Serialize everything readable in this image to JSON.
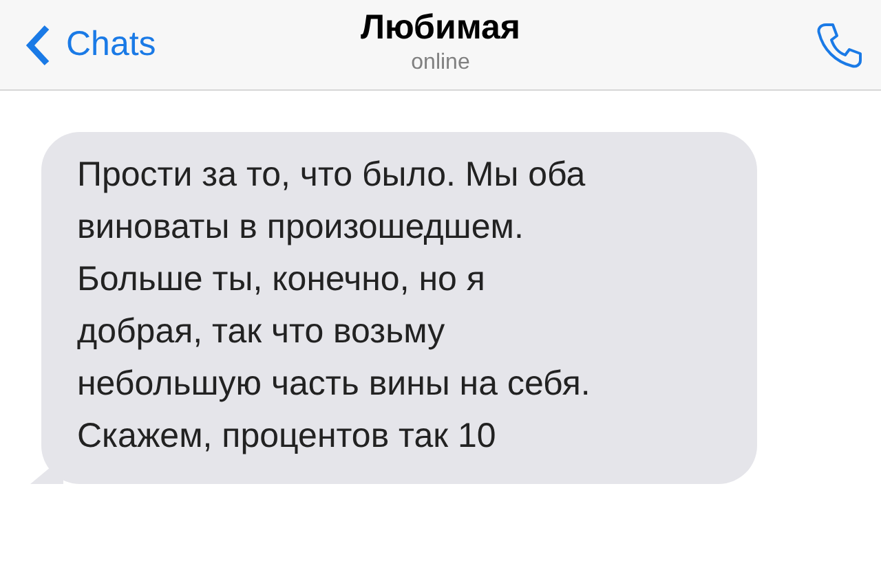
{
  "header": {
    "back_label": "Chats",
    "title": "Любимая",
    "status": "online"
  },
  "messages": [
    {
      "kind": "incoming",
      "text": "Прости за то, что было. Мы оба\nвиноваты в произошедшем.\nБольше ты, конечно, но я\nдобрая, так что возьму\nнебольшую часть вины на себя.\nСкажем, процентов так 10"
    }
  ]
}
